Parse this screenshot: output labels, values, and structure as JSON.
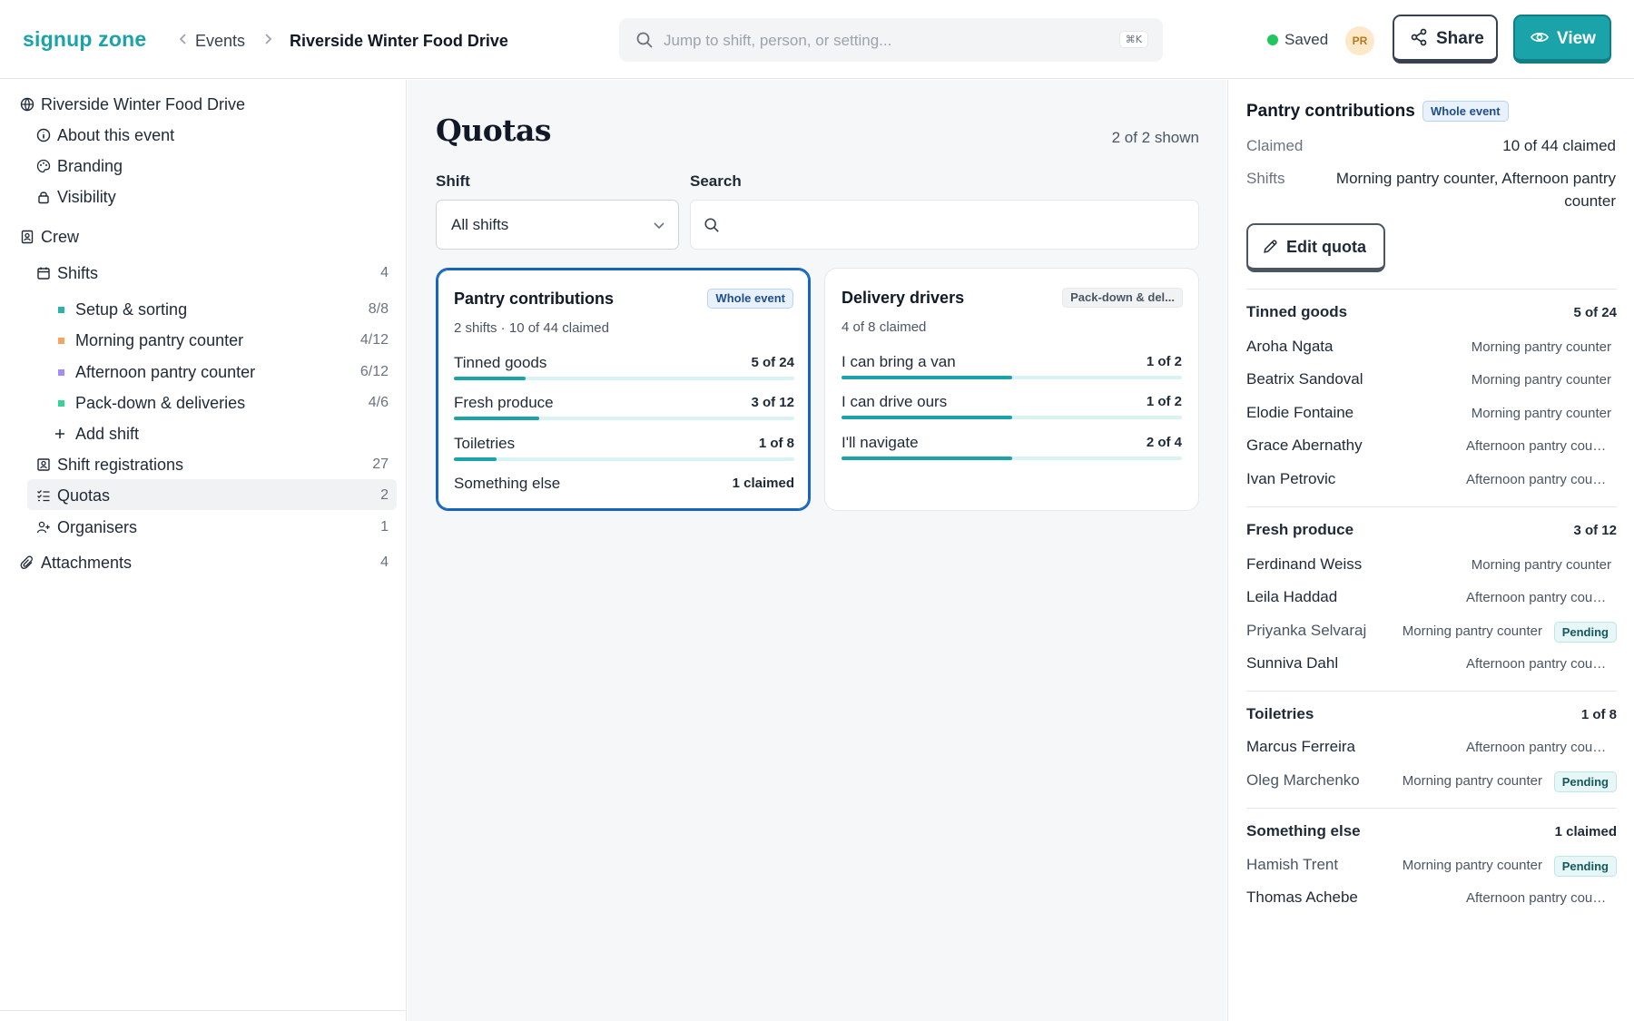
{
  "header": {
    "brand": "signup zone",
    "breadcrumb_parent": "Events",
    "breadcrumb_current": "Riverside Winter Food Drive",
    "search_placeholder": "Jump to shift, person, or setting...",
    "search_shortcut": "⌘K",
    "status": "Saved",
    "avatar_initials": "PR",
    "share_label": "Share",
    "view_label": "View"
  },
  "sidebar": {
    "event_name": "Riverside Winter Food Drive",
    "about": "About this event",
    "branding": "Branding",
    "visibility": "Visibility",
    "crew": "Crew",
    "shifts": {
      "label": "Shifts",
      "count": "4"
    },
    "shift_items": [
      {
        "label": "Setup & sorting",
        "count": "8/8",
        "color": "#2bb3a7"
      },
      {
        "label": "Morning pantry counter",
        "count": "4/12",
        "color": "#f6a560"
      },
      {
        "label": "Afternoon pantry counter",
        "count": "6/12",
        "color": "#a78bfa"
      },
      {
        "label": "Pack-down & deliveries",
        "count": "4/6",
        "color": "#34d399"
      }
    ],
    "add_shift": "Add shift",
    "shift_registrations": {
      "label": "Shift registrations",
      "count": "27"
    },
    "quotas": {
      "label": "Quotas",
      "count": "2"
    },
    "organisers": {
      "label": "Organisers",
      "count": "1"
    },
    "attachments": {
      "label": "Attachments",
      "count": "4"
    }
  },
  "main": {
    "title": "Quotas",
    "shown": "2 of 2 shown",
    "shift_label": "Shift",
    "shift_value": "All shifts",
    "search_label": "Search",
    "search_value": "",
    "cards": [
      {
        "title": "Pantry contributions",
        "badge": "Whole event",
        "subtitle": "2 shifts · 10 of 44 claimed",
        "rows": [
          {
            "name": "Tinned goods",
            "count": "5 of 24",
            "fill": 0.21
          },
          {
            "name": "Fresh produce",
            "count": "3 of 12",
            "fill": 0.25
          },
          {
            "name": "Toiletries",
            "count": "1 of 8",
            "fill": 0.125
          },
          {
            "name": "Something else",
            "count": "1 claimed"
          }
        ]
      },
      {
        "title": "Delivery drivers",
        "badge": "Pack-down & del...",
        "subtitle": "4 of 8 claimed",
        "rows": [
          {
            "name": "I can bring a van",
            "count": "1 of 2",
            "fill": 0.5
          },
          {
            "name": "I can drive ours",
            "count": "1 of 2",
            "fill": 0.5
          },
          {
            "name": "I'll navigate",
            "count": "2 of 4",
            "fill": 0.5
          }
        ]
      }
    ]
  },
  "detail": {
    "title": "Pantry contributions",
    "badge": "Whole event",
    "claimed_label": "Claimed",
    "claimed_value": "10 of 44 claimed",
    "shifts_label": "Shifts",
    "shifts_value_1": "Morning pantry counter, Afternoon pantry",
    "shifts_value_2": "counter",
    "edit_label": "Edit quota",
    "groups": [
      {
        "title": "Tinned goods",
        "count": "5 of 24",
        "people": [
          {
            "name": "Aroha Ngata",
            "shift": "Morning pantry counter"
          },
          {
            "name": "Beatrix Sandoval",
            "shift": "Morning pantry counter"
          },
          {
            "name": "Elodie Fontaine",
            "shift": "Morning pantry counter"
          },
          {
            "name": "Grace Abernathy",
            "shift": "Afternoon pantry counter"
          },
          {
            "name": "Ivan Petrovic",
            "shift": "Afternoon pantry counter"
          }
        ]
      },
      {
        "title": "Fresh produce",
        "count": "3 of 12",
        "people": [
          {
            "name": "Ferdinand Weiss",
            "shift": "Morning pantry counter"
          },
          {
            "name": "Leila Haddad",
            "shift": "Afternoon pantry counter"
          },
          {
            "name": "Priyanka Selvaraj",
            "shift": "Morning pantry counter",
            "status": "Pending"
          },
          {
            "name": "Sunniva Dahl",
            "shift": "Afternoon pantry counter"
          }
        ]
      },
      {
        "title": "Toiletries",
        "count": "1 of 8",
        "people": [
          {
            "name": "Marcus Ferreira",
            "shift": "Afternoon pantry counter"
          },
          {
            "name": "Oleg Marchenko",
            "shift": "Morning pantry counter",
            "status": "Pending"
          }
        ]
      },
      {
        "title": "Something else",
        "count": "1 claimed",
        "people": [
          {
            "name": "Hamish Trent",
            "shift": "Morning pantry counter",
            "status": "Pending"
          },
          {
            "name": "Thomas Achebe",
            "shift": "Afternoon pantry counter"
          }
        ]
      }
    ]
  }
}
